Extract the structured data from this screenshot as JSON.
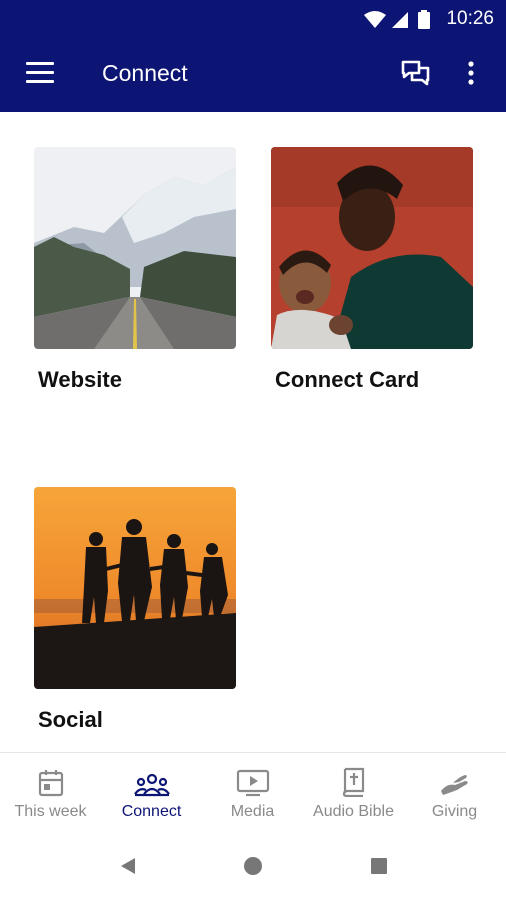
{
  "status_bar": {
    "time": "10:26",
    "icons": [
      "wifi-icon",
      "signal-icon",
      "battery-icon"
    ]
  },
  "app_bar": {
    "title": "Connect",
    "icons": [
      "menu-icon",
      "chat-icon",
      "more-vert-icon"
    ]
  },
  "tiles": [
    {
      "label": "Website",
      "image": "mountain-road-photo"
    },
    {
      "label": "Connect Card",
      "image": "father-and-baby-photo"
    },
    {
      "label": "Social",
      "image": "family-sunset-silhouette-photo"
    }
  ],
  "bottom_nav": {
    "items": [
      {
        "label": "This week",
        "icon": "calendar-icon",
        "active": false
      },
      {
        "label": "Connect",
        "icon": "group-icon",
        "active": true
      },
      {
        "label": "Media",
        "icon": "play-screen-icon",
        "active": false
      },
      {
        "label": "Audio Bible",
        "icon": "bible-icon",
        "active": false
      },
      {
        "label": "Giving",
        "icon": "giving-hand-icon",
        "active": false
      }
    ]
  },
  "colors": {
    "primary": "#0d1574",
    "inactive": "#8a8a8a",
    "active": "#0d1574"
  }
}
